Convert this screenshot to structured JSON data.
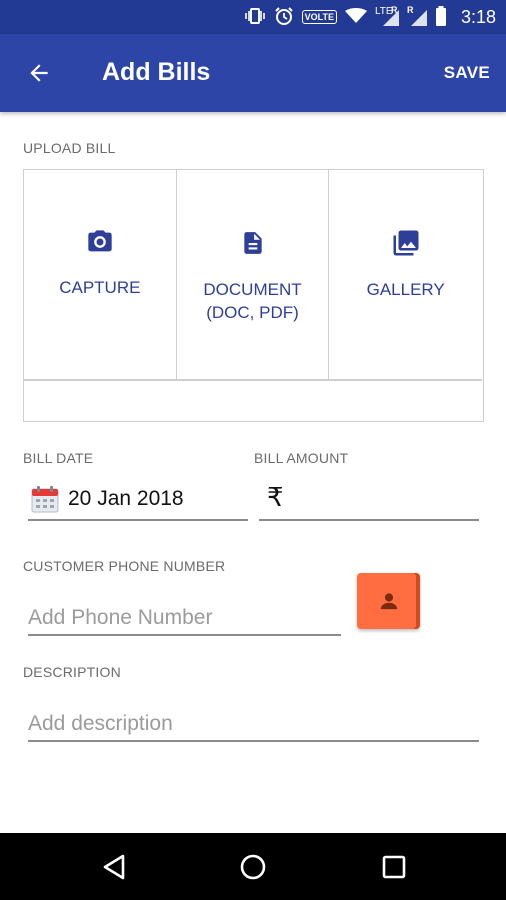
{
  "status_bar": {
    "network_badge": "VOLTE",
    "lte_label": "LTE",
    "roaming_1": "R",
    "roaming_2": "R",
    "time": "3:18"
  },
  "app_bar": {
    "title": "Add Bills",
    "save_label": "SAVE",
    "back_icon": "arrow-left-icon"
  },
  "upload": {
    "label": "UPLOAD BILL",
    "options": [
      {
        "label": "CAPTURE",
        "icon": "camera-icon"
      },
      {
        "label": "DOCUMENT\n(DOC, PDF)",
        "icon": "document-icon"
      },
      {
        "label": "GALLERY",
        "icon": "gallery-icon"
      }
    ]
  },
  "bill_date": {
    "label": "BILL DATE",
    "value": "20 Jan 2018",
    "icon": "calendar-icon"
  },
  "bill_amount": {
    "label": "BILL AMOUNT",
    "currency": "₹",
    "value": ""
  },
  "phone": {
    "label": "CUSTOMER PHONE NUMBER",
    "placeholder": "Add Phone Number",
    "contact_icon": "contact-icon"
  },
  "description": {
    "label": "DESCRIPTION",
    "placeholder": "Add description"
  },
  "colors": {
    "primary": "#2d45a7",
    "status_bar": "#233a94",
    "accent": "#ff6d40",
    "upload_text": "#2d3f99"
  }
}
